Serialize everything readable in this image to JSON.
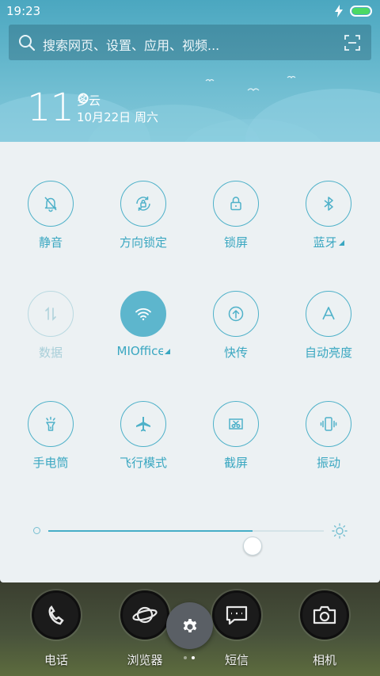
{
  "status_bar": {
    "time": "19:23",
    "battery_level": 1.0,
    "battery_color": "#4cd964",
    "charging": true
  },
  "search": {
    "placeholder": "搜索网页、设置、应用、视频..."
  },
  "weather": {
    "temperature": "11°",
    "condition": "多云",
    "date": "10月22日 周六"
  },
  "quick_settings": {
    "tiles": [
      {
        "label": "静音",
        "icon": "mute-bell-icon",
        "state": "off"
      },
      {
        "label": "方向锁定",
        "icon": "rotation-lock-icon",
        "state": "off"
      },
      {
        "label": "锁屏",
        "icon": "lock-icon",
        "state": "off"
      },
      {
        "label": "蓝牙",
        "icon": "bluetooth-icon",
        "state": "off",
        "has_menu": true
      },
      {
        "label": "数据",
        "icon": "mobile-data-icon",
        "state": "disabled"
      },
      {
        "label": "MIOffice",
        "icon": "wifi-icon",
        "state": "on",
        "has_menu": true
      },
      {
        "label": "快传",
        "icon": "quick-transfer-icon",
        "state": "off"
      },
      {
        "label": "自动亮度",
        "icon": "auto-brightness-icon",
        "state": "off"
      },
      {
        "label": "手电筒",
        "icon": "flashlight-icon",
        "state": "off"
      },
      {
        "label": "飞行模式",
        "icon": "airplane-icon",
        "state": "off"
      },
      {
        "label": "截屏",
        "icon": "screenshot-icon",
        "state": "off"
      },
      {
        "label": "振动",
        "icon": "vibrate-icon",
        "state": "off"
      }
    ],
    "brightness": {
      "level": 0.74
    },
    "accent_color": "#4eb1c9"
  },
  "dock": {
    "items": [
      {
        "label": "电话",
        "icon": "phone-icon"
      },
      {
        "label": "浏览器",
        "icon": "browser-icon"
      },
      {
        "label": "短信",
        "icon": "message-icon"
      },
      {
        "label": "相机",
        "icon": "camera-icon"
      }
    ],
    "settings_button_icon": "gear-icon",
    "page_count": 2,
    "current_page": 2
  }
}
